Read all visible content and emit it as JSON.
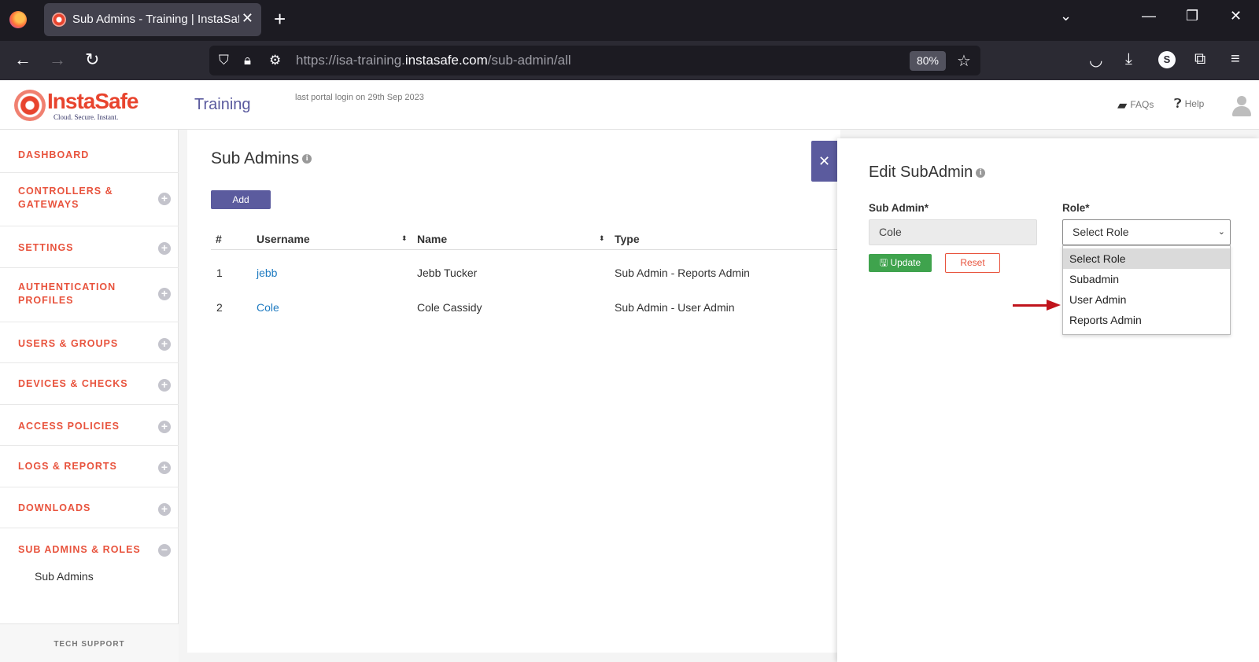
{
  "browser": {
    "tab_title": "Sub Admins - Training | InstaSafe",
    "url_prefix": "https://isa-training.",
    "url_domain": "instasafe.com",
    "url_path": "/sub-admin/all",
    "zoom": "80%",
    "profile_initial": "S"
  },
  "header": {
    "logo_name": "InstaSafe",
    "logo_tagline": "Cloud. Secure. Instant.",
    "portal_title": "Training",
    "last_login": "last portal login on 29th Sep 2023",
    "faqs_label": "FAQs",
    "help_label": "Help"
  },
  "sidebar": {
    "items": [
      {
        "label": "DASHBOARD"
      },
      {
        "label": "CONTROLLERS & GATEWAYS",
        "line1": "CONTROLLERS &",
        "line2": "GATEWAYS"
      },
      {
        "label": "SETTINGS"
      },
      {
        "label": "AUTHENTICATION PROFILES",
        "line1": "AUTHENTICATION",
        "line2": "PROFILES"
      },
      {
        "label": "USERS & GROUPS"
      },
      {
        "label": "DEVICES & CHECKS"
      },
      {
        "label": "ACCESS POLICIES"
      },
      {
        "label": "LOGS & REPORTS"
      },
      {
        "label": "DOWNLOADS"
      },
      {
        "label": "SUB ADMINS & ROLES"
      }
    ],
    "sub_item": "Sub Admins",
    "tech_support": "TECH SUPPORT"
  },
  "main": {
    "title": "Sub Admins",
    "add_label": "Add",
    "columns": [
      "#",
      "Username",
      "Name",
      "Type"
    ],
    "rows": [
      {
        "num": "1",
        "username": "jebb",
        "name": "Jebb Tucker",
        "type": "Sub Admin - Reports Admin"
      },
      {
        "num": "2",
        "username": "Cole",
        "name": "Cole Cassidy",
        "type": "Sub Admin - User Admin"
      }
    ]
  },
  "panel": {
    "title": "Edit SubAdmin",
    "sub_admin_label": "Sub Admin*",
    "sub_admin_value": "Cole",
    "role_label": "Role*",
    "role_selected": "Select Role",
    "role_options": [
      "Select Role",
      "Subadmin",
      "User Admin",
      "Reports Admin"
    ],
    "update_label": "Update",
    "reset_label": "Reset"
  },
  "colors": {
    "accent": "#5b5b9e",
    "sidebar_text": "#e8533d",
    "link": "#1f7bc1",
    "update": "#3fa34d",
    "annotation_arrow": "#c0141c"
  }
}
